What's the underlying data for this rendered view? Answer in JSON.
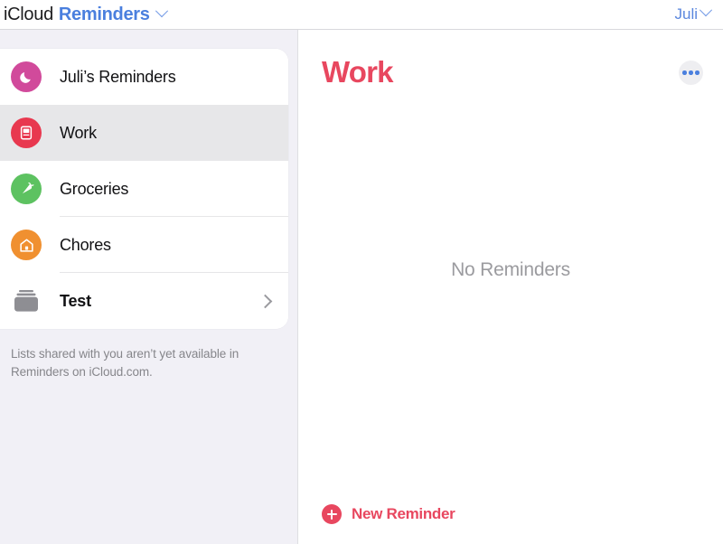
{
  "header": {
    "brand_primary": "iCloud",
    "brand_app": "Reminders",
    "brand_chevron_icon": "chevron-down-icon",
    "account_name": "Juli",
    "account_chevron_icon": "chevron-down-icon"
  },
  "sidebar": {
    "lists": [
      {
        "label": "Juli’s Reminders",
        "icon": "moon-icon",
        "color": "#d14a9b",
        "selected": false,
        "bold": false,
        "separator": false,
        "chevron": false
      },
      {
        "label": "Work",
        "icon": "computer-icon",
        "color": "#e8384f",
        "selected": true,
        "bold": false,
        "separator": false,
        "chevron": false
      },
      {
        "label": "Groceries",
        "icon": "carrot-icon",
        "color": "#5dc261",
        "selected": false,
        "bold": false,
        "separator": true,
        "chevron": false
      },
      {
        "label": "Chores",
        "icon": "house-icon",
        "color": "#f09030",
        "selected": false,
        "bold": false,
        "separator": true,
        "chevron": false
      },
      {
        "label": "Test",
        "icon": "group-folder-icon",
        "color": "#8e8e93",
        "selected": false,
        "bold": true,
        "separator": false,
        "chevron": true
      }
    ],
    "note": "Lists shared with you aren’t yet available in Reminders on iCloud.com."
  },
  "main": {
    "title": "Work",
    "title_color": "#e8475f",
    "more_button_icon": "more-options-icon",
    "empty_state": "No Reminders",
    "new_reminder_label": "New Reminder",
    "new_reminder_icon": "plus-circle-icon"
  }
}
